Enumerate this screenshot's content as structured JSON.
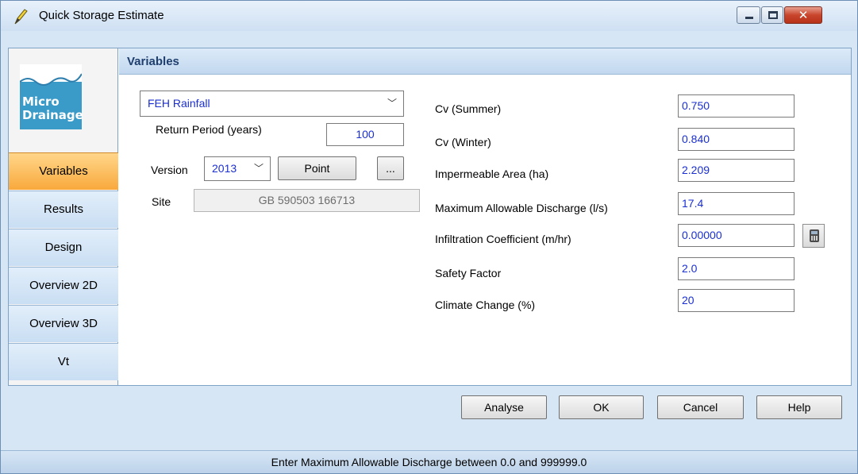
{
  "window": {
    "title": "Quick Storage Estimate",
    "controls": {
      "close_glyph": "✕"
    }
  },
  "sidebar": {
    "logo": {
      "line1": "Micro",
      "line2": "Drainage"
    },
    "items": [
      {
        "label": "Variables",
        "active": true
      },
      {
        "label": "Results",
        "active": false
      },
      {
        "label": "Design",
        "active": false
      },
      {
        "label": "Overview 2D",
        "active": false
      },
      {
        "label": "Overview 3D",
        "active": false
      },
      {
        "label": "Vt",
        "active": false
      }
    ]
  },
  "panel": {
    "title": "Variables",
    "rainfall": {
      "selected": "FEH Rainfall"
    },
    "return_period": {
      "label": "Return Period (years)",
      "value": "100"
    },
    "version": {
      "label": "Version",
      "selected": "2013",
      "point_label": "Point",
      "browse_label": "..."
    },
    "site": {
      "label": "Site",
      "value": "GB 590503 166713"
    },
    "params": [
      {
        "label": "Cv (Summer)",
        "value": "0.750"
      },
      {
        "label": "Cv (Winter)",
        "value": "0.840"
      },
      {
        "label": "Impermeable Area (ha)",
        "value": "2.209"
      },
      {
        "label": "Maximum Allowable Discharge (l/s)",
        "value": "17.4"
      },
      {
        "label": "Infiltration Coefficient (m/hr)",
        "value": "0.00000"
      },
      {
        "label": "Safety Factor",
        "value": "2.0"
      },
      {
        "label": "Climate Change (%)",
        "value": "20"
      }
    ]
  },
  "buttons": {
    "analyse": "Analyse",
    "ok": "OK",
    "cancel": "Cancel",
    "help": "Help"
  },
  "status": "Enter Maximum Allowable Discharge between 0.0 and 999999.0",
  "icons": {
    "title_icon": "pencil-icon",
    "calculator": "calculator-icon",
    "chevron": "chevron-down-icon"
  },
  "colors": {
    "value_text": "#1b2fd1",
    "active_tab": "#f9a93c",
    "logo": "#3a9ac8",
    "header_text": "#1f3f6e"
  }
}
